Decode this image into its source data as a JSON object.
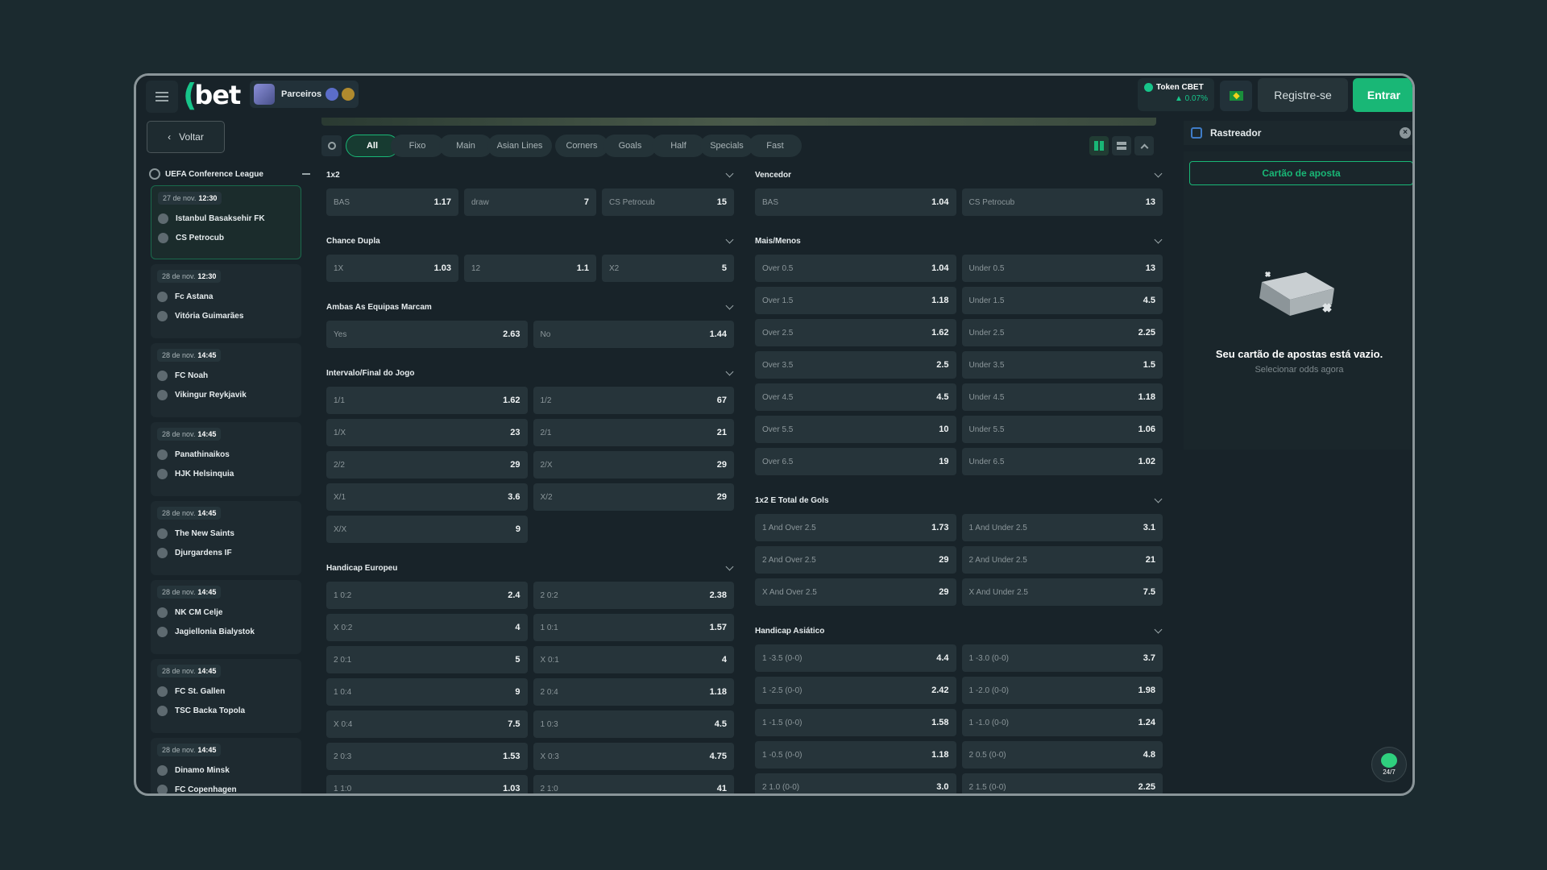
{
  "header": {
    "logo": "bet",
    "partners_label": "Parceiros",
    "token_label": "Token CBET",
    "token_change": "▲ 0.07%",
    "register_label": "Registre-se",
    "login_label": "Entrar"
  },
  "sidebar": {
    "back_label": "Voltar",
    "league": "UEFA Conference League",
    "matches": [
      {
        "date": "27 de nov.",
        "time": "12:30",
        "home": "Istanbul Basaksehir FK",
        "away": "CS Petrocub"
      },
      {
        "date": "28 de nov.",
        "time": "12:30",
        "home": "Fc Astana",
        "away": "Vitória Guimarães"
      },
      {
        "date": "28 de nov.",
        "time": "14:45",
        "home": "FC Noah",
        "away": "Vikingur Reykjavik"
      },
      {
        "date": "28 de nov.",
        "time": "14:45",
        "home": "Panathinaikos",
        "away": "HJK Helsinquia"
      },
      {
        "date": "28 de nov.",
        "time": "14:45",
        "home": "The New Saints",
        "away": "Djurgardens IF"
      },
      {
        "date": "28 de nov.",
        "time": "14:45",
        "home": "NK CM Celje",
        "away": "Jagiellonia Bialystok"
      },
      {
        "date": "28 de nov.",
        "time": "14:45",
        "home": "FC St. Gallen",
        "away": "TSC Backa Topola"
      },
      {
        "date": "28 de nov.",
        "time": "14:45",
        "home": "Dinamo Minsk",
        "away": "FC Copenhagen"
      }
    ]
  },
  "filters": [
    "All",
    "Fixo",
    "Main",
    "Asian Lines",
    "Corners",
    "Goals",
    "Half",
    "Specials",
    "Fast"
  ],
  "markets_left": [
    {
      "title": "1x2",
      "cols": 3,
      "rows": [
        [
          [
            "BAS",
            "1.17"
          ],
          [
            "draw",
            "7"
          ],
          [
            "CS Petrocub",
            "15"
          ]
        ]
      ]
    },
    {
      "title": "Chance Dupla",
      "cols": 3,
      "rows": [
        [
          [
            "1X",
            "1.03"
          ],
          [
            "12",
            "1.1"
          ],
          [
            "X2",
            "5"
          ]
        ]
      ]
    },
    {
      "title": "Ambas As Equipas Marcam",
      "cols": 2,
      "rows": [
        [
          [
            "Yes",
            "2.63"
          ],
          [
            "No",
            "1.44"
          ]
        ]
      ]
    },
    {
      "title": "Intervalo/Final do Jogo",
      "cols": 2,
      "rows": [
        [
          [
            "1/1",
            "1.62"
          ],
          [
            "1/2",
            "67"
          ]
        ],
        [
          [
            "1/X",
            "23"
          ],
          [
            "2/1",
            "21"
          ]
        ],
        [
          [
            "2/2",
            "29"
          ],
          [
            "2/X",
            "29"
          ]
        ],
        [
          [
            "X/1",
            "3.6"
          ],
          [
            "X/2",
            "29"
          ]
        ],
        [
          [
            "X/X",
            "9"
          ]
        ]
      ]
    },
    {
      "title": "Handicap Europeu",
      "cols": 2,
      "rows": [
        [
          [
            "1 0:2",
            "2.4"
          ],
          [
            "2 0:2",
            "2.38"
          ]
        ],
        [
          [
            "X 0:2",
            "4"
          ],
          [
            "1 0:1",
            "1.57"
          ]
        ],
        [
          [
            "2 0:1",
            "5"
          ],
          [
            "X 0:1",
            "4"
          ]
        ],
        [
          [
            "1 0:4",
            "9"
          ],
          [
            "2 0:4",
            "1.18"
          ]
        ],
        [
          [
            "X 0:4",
            "7.5"
          ],
          [
            "1 0:3",
            "4.5"
          ]
        ],
        [
          [
            "2 0:3",
            "1.53"
          ],
          [
            "X 0:3",
            "4.75"
          ]
        ],
        [
          [
            "1 1:0",
            "1.03"
          ],
          [
            "2 1:0",
            "41"
          ]
        ]
      ]
    }
  ],
  "markets_right": [
    {
      "title": "Vencedor",
      "cols": 2,
      "rows": [
        [
          [
            "BAS",
            "1.04"
          ],
          [
            "CS Petrocub",
            "13"
          ]
        ]
      ]
    },
    {
      "title": "Mais/Menos",
      "cols": 2,
      "rows": [
        [
          [
            "Over 0.5",
            "1.04"
          ],
          [
            "Under 0.5",
            "13"
          ]
        ],
        [
          [
            "Over 1.5",
            "1.18"
          ],
          [
            "Under 1.5",
            "4.5"
          ]
        ],
        [
          [
            "Over 2.5",
            "1.62"
          ],
          [
            "Under 2.5",
            "2.25"
          ]
        ],
        [
          [
            "Over 3.5",
            "2.5"
          ],
          [
            "Under 3.5",
            "1.5"
          ]
        ],
        [
          [
            "Over 4.5",
            "4.5"
          ],
          [
            "Under 4.5",
            "1.18"
          ]
        ],
        [
          [
            "Over 5.5",
            "10"
          ],
          [
            "Under 5.5",
            "1.06"
          ]
        ],
        [
          [
            "Over 6.5",
            "19"
          ],
          [
            "Under 6.5",
            "1.02"
          ]
        ]
      ]
    },
    {
      "title": "1x2 E Total de Gols",
      "cols": 2,
      "rows": [
        [
          [
            "1 And Over 2.5",
            "1.73"
          ],
          [
            "1 And Under 2.5",
            "3.1"
          ]
        ],
        [
          [
            "2 And Over 2.5",
            "29"
          ],
          [
            "2 And Under 2.5",
            "21"
          ]
        ],
        [
          [
            "X And Over 2.5",
            "29"
          ],
          [
            "X And Under 2.5",
            "7.5"
          ]
        ]
      ]
    },
    {
      "title": "Handicap Asiático",
      "cols": 2,
      "rows": [
        [
          [
            "1 -3.5 (0-0)",
            "4.4"
          ],
          [
            "1 -3.0 (0-0)",
            "3.7"
          ]
        ],
        [
          [
            "1 -2.5 (0-0)",
            "2.42"
          ],
          [
            "1 -2.0 (0-0)",
            "1.98"
          ]
        ],
        [
          [
            "1 -1.5 (0-0)",
            "1.58"
          ],
          [
            "1 -1.0 (0-0)",
            "1.24"
          ]
        ],
        [
          [
            "1 -0.5 (0-0)",
            "1.18"
          ],
          [
            "2 0.5 (0-0)",
            "4.8"
          ]
        ],
        [
          [
            "2 1.0 (0-0)",
            "3.0"
          ],
          [
            "2 1.5 (0-0)",
            "2.25"
          ]
        ]
      ]
    }
  ],
  "right_panel": {
    "tracker_label": "Rastreador",
    "betslip_tab": "Cartão de aposta",
    "empty_title": "Seu cartão de apostas está vazio.",
    "empty_sub": "Selecionar odds agora",
    "support_label": "24/7"
  },
  "colors": {
    "accent": "#19b776",
    "bg": "#182329",
    "odd_bg": "#26343a"
  }
}
